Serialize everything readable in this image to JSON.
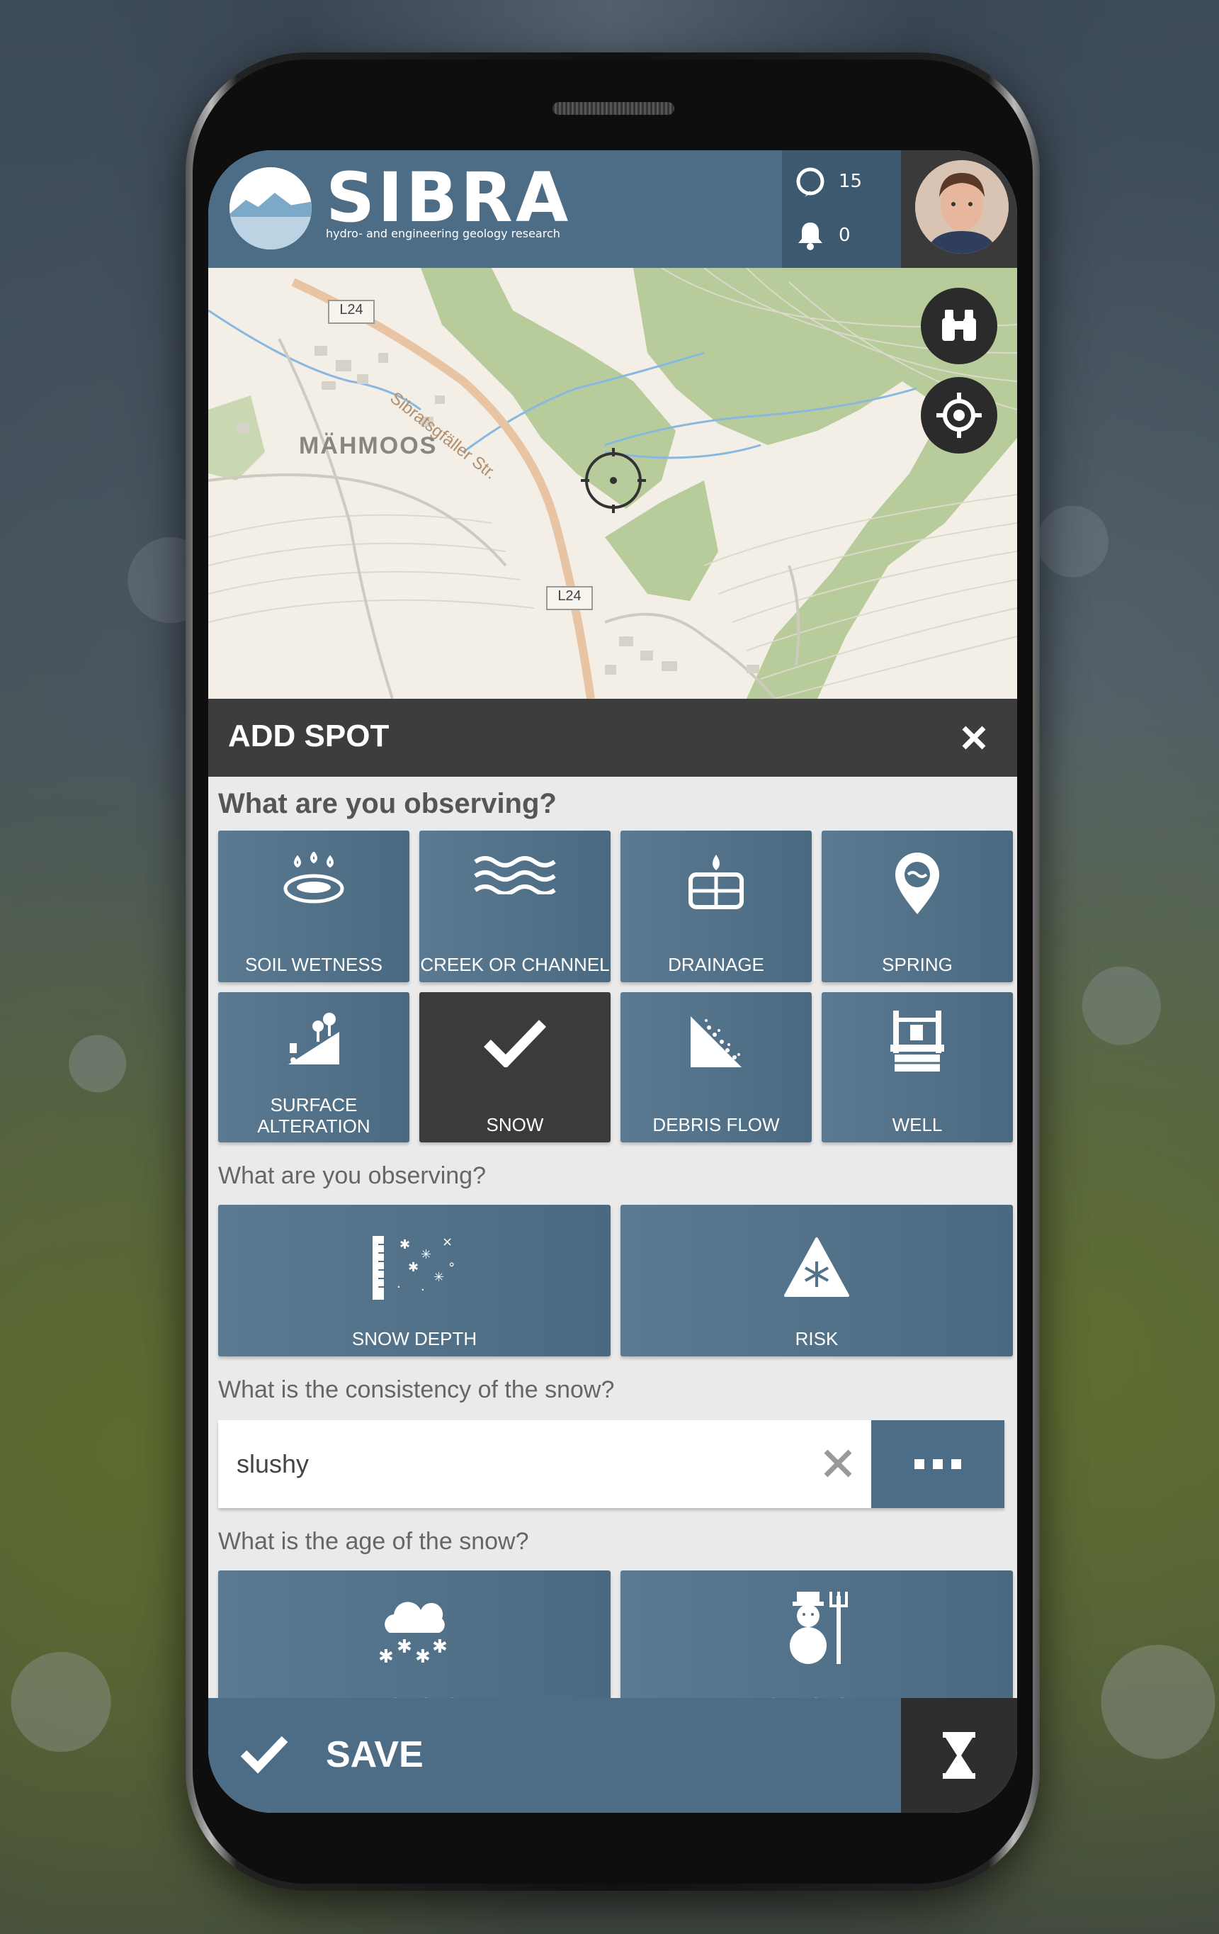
{
  "app": {
    "brand": "SIBRA",
    "tagline": "hydro- and engineering geology research",
    "spots_count": "15",
    "notifications_count": "0"
  },
  "map": {
    "place_label": "MÄHMOOS",
    "road_label": "Sibratsgfäller Str.",
    "road_badge_1": "L24",
    "road_badge_2": "L24"
  },
  "panel": {
    "title": "ADD SPOT",
    "q1": "What are you observing?",
    "categories": [
      {
        "label": "SOIL WETNESS",
        "icon": "soil-wetness-icon"
      },
      {
        "label": "CREEK OR CHANNEL",
        "icon": "waves-icon"
      },
      {
        "label": "DRAINAGE",
        "icon": "drainage-icon"
      },
      {
        "label": "SPRING",
        "icon": "spring-pin-icon"
      },
      {
        "label": "SURFACE ALTERATION",
        "icon": "surface-alteration-icon"
      },
      {
        "label": "SNOW",
        "icon": "checkmark-icon",
        "selected": true
      },
      {
        "label": "DEBRIS FLOW",
        "icon": "debris-flow-icon"
      },
      {
        "label": "WELL",
        "icon": "well-icon"
      }
    ],
    "q2": "What are you observing?",
    "snow_options": [
      {
        "label": "SNOW DEPTH",
        "icon": "snow-depth-icon"
      },
      {
        "label": "RISK",
        "icon": "avalanche-risk-icon"
      }
    ],
    "q3": "What is the consistency of the snow?",
    "consistency_value": "slushy",
    "q4": "What is the age of the snow?",
    "age_options": [
      {
        "label": "FRESH SNOW",
        "icon": "fresh-snow-icon"
      },
      {
        "label": "OLD SNOW",
        "icon": "old-snow-icon"
      }
    ],
    "save_label": "SAVE"
  },
  "colors": {
    "primary": "#4d6d86",
    "dark": "#3d3d3d",
    "selected": "#3b3b3b"
  }
}
